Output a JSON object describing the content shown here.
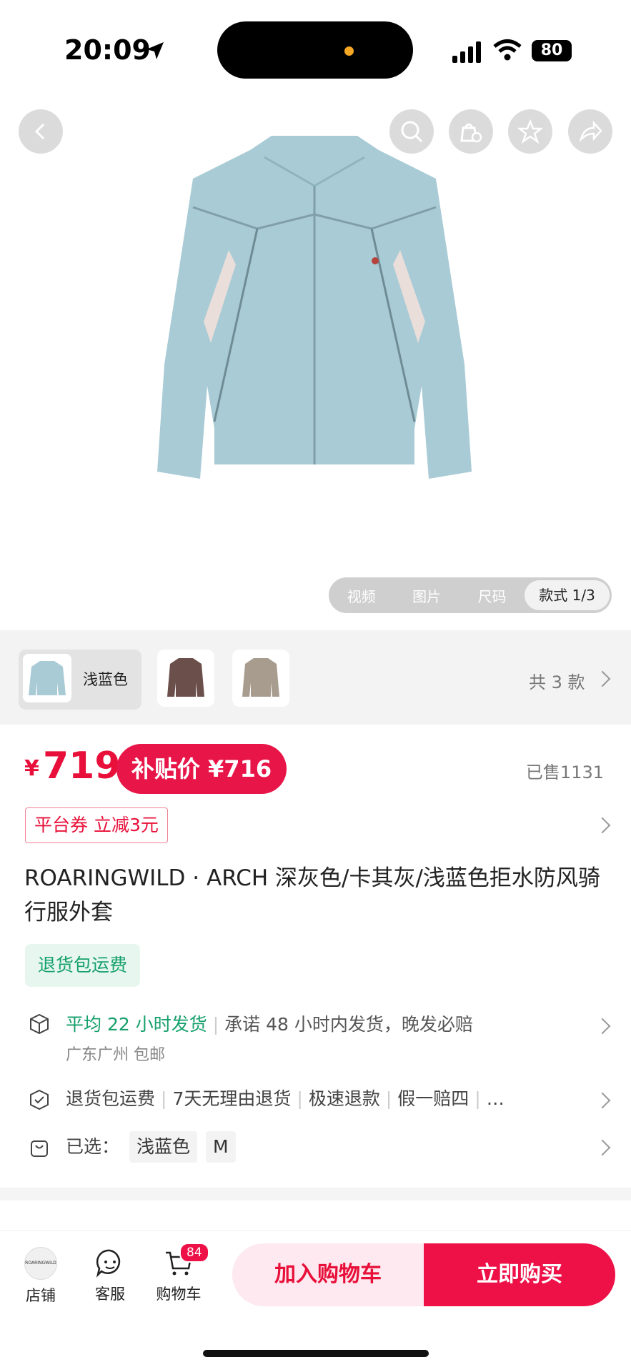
{
  "status_bar": {
    "time": "20:09",
    "battery": "80"
  },
  "media_tabs": [
    "视频",
    "图片",
    "尺码",
    "款式 1/3"
  ],
  "variants": {
    "selected_label": "浅蓝色",
    "count_label": "共 3 款"
  },
  "price": {
    "symbol": "¥",
    "value": "719",
    "subsidy_label": "补贴价 ¥716",
    "sold": "已售1131"
  },
  "coupon": "平台券 立减3元",
  "title": "ROARINGWILD · ARCH 深灰色/卡其灰/浅蓝色拒水防风骑行服外套",
  "return_badge": "退货包运费",
  "shipping": {
    "highlight": "平均 22 小时发货",
    "promise": "承诺 48 小时内发货，晚发必赔",
    "location": "广东广州 包邮"
  },
  "guarantees": [
    "退货包运费",
    "7天无理由退货",
    "极速退款",
    "假一赔四",
    "…"
  ],
  "selected": {
    "label": "已选：",
    "tags": [
      "浅蓝色",
      "M"
    ]
  },
  "bottom_nav": {
    "store": "店铺",
    "service": "客服",
    "cart": "购物车",
    "cart_count": "84",
    "store_logo": "ROARINGWILD"
  },
  "actions": {
    "add_to_cart": "加入购物车",
    "buy_now": "立即购买"
  },
  "colors": {
    "accent": "#e8103a",
    "green": "#16a06b",
    "jacket": "#a9cbd6"
  }
}
